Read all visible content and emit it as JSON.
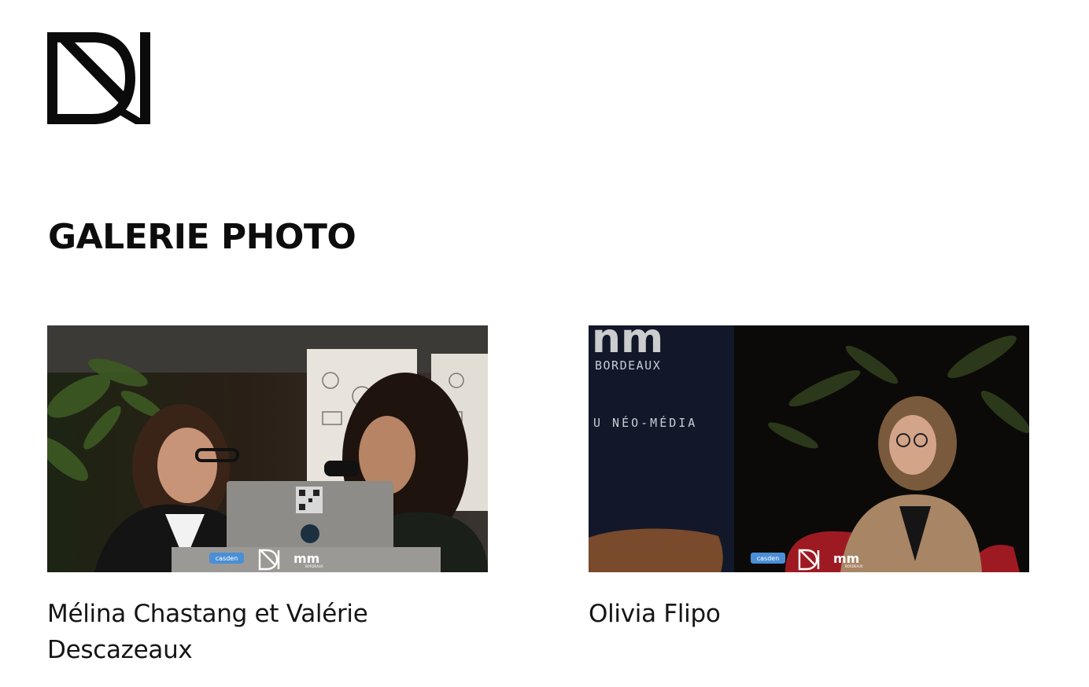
{
  "header": {
    "logo_icon": "dn-monogram-logo"
  },
  "main": {
    "title": "GALERIE PHOTO",
    "gallery": [
      {
        "caption": "Mélina Chastang et Valérie Descazeaux",
        "overlay": {
          "sponsor": "casden",
          "logo2": "mm",
          "logo2_sub": "BORDEAUX"
        }
      },
      {
        "caption": "Olivia Flipo",
        "backdrop": {
          "line1": "BORDEAUX",
          "line2": "U NÉO-MÉDIA"
        },
        "overlay": {
          "sponsor": "casden",
          "logo2": "mm",
          "logo2_sub": "BORDEAUX"
        }
      }
    ]
  },
  "colors": {
    "background": "#ffffff",
    "text": "#111111",
    "sponsor_badge": "#4a8fd6"
  }
}
